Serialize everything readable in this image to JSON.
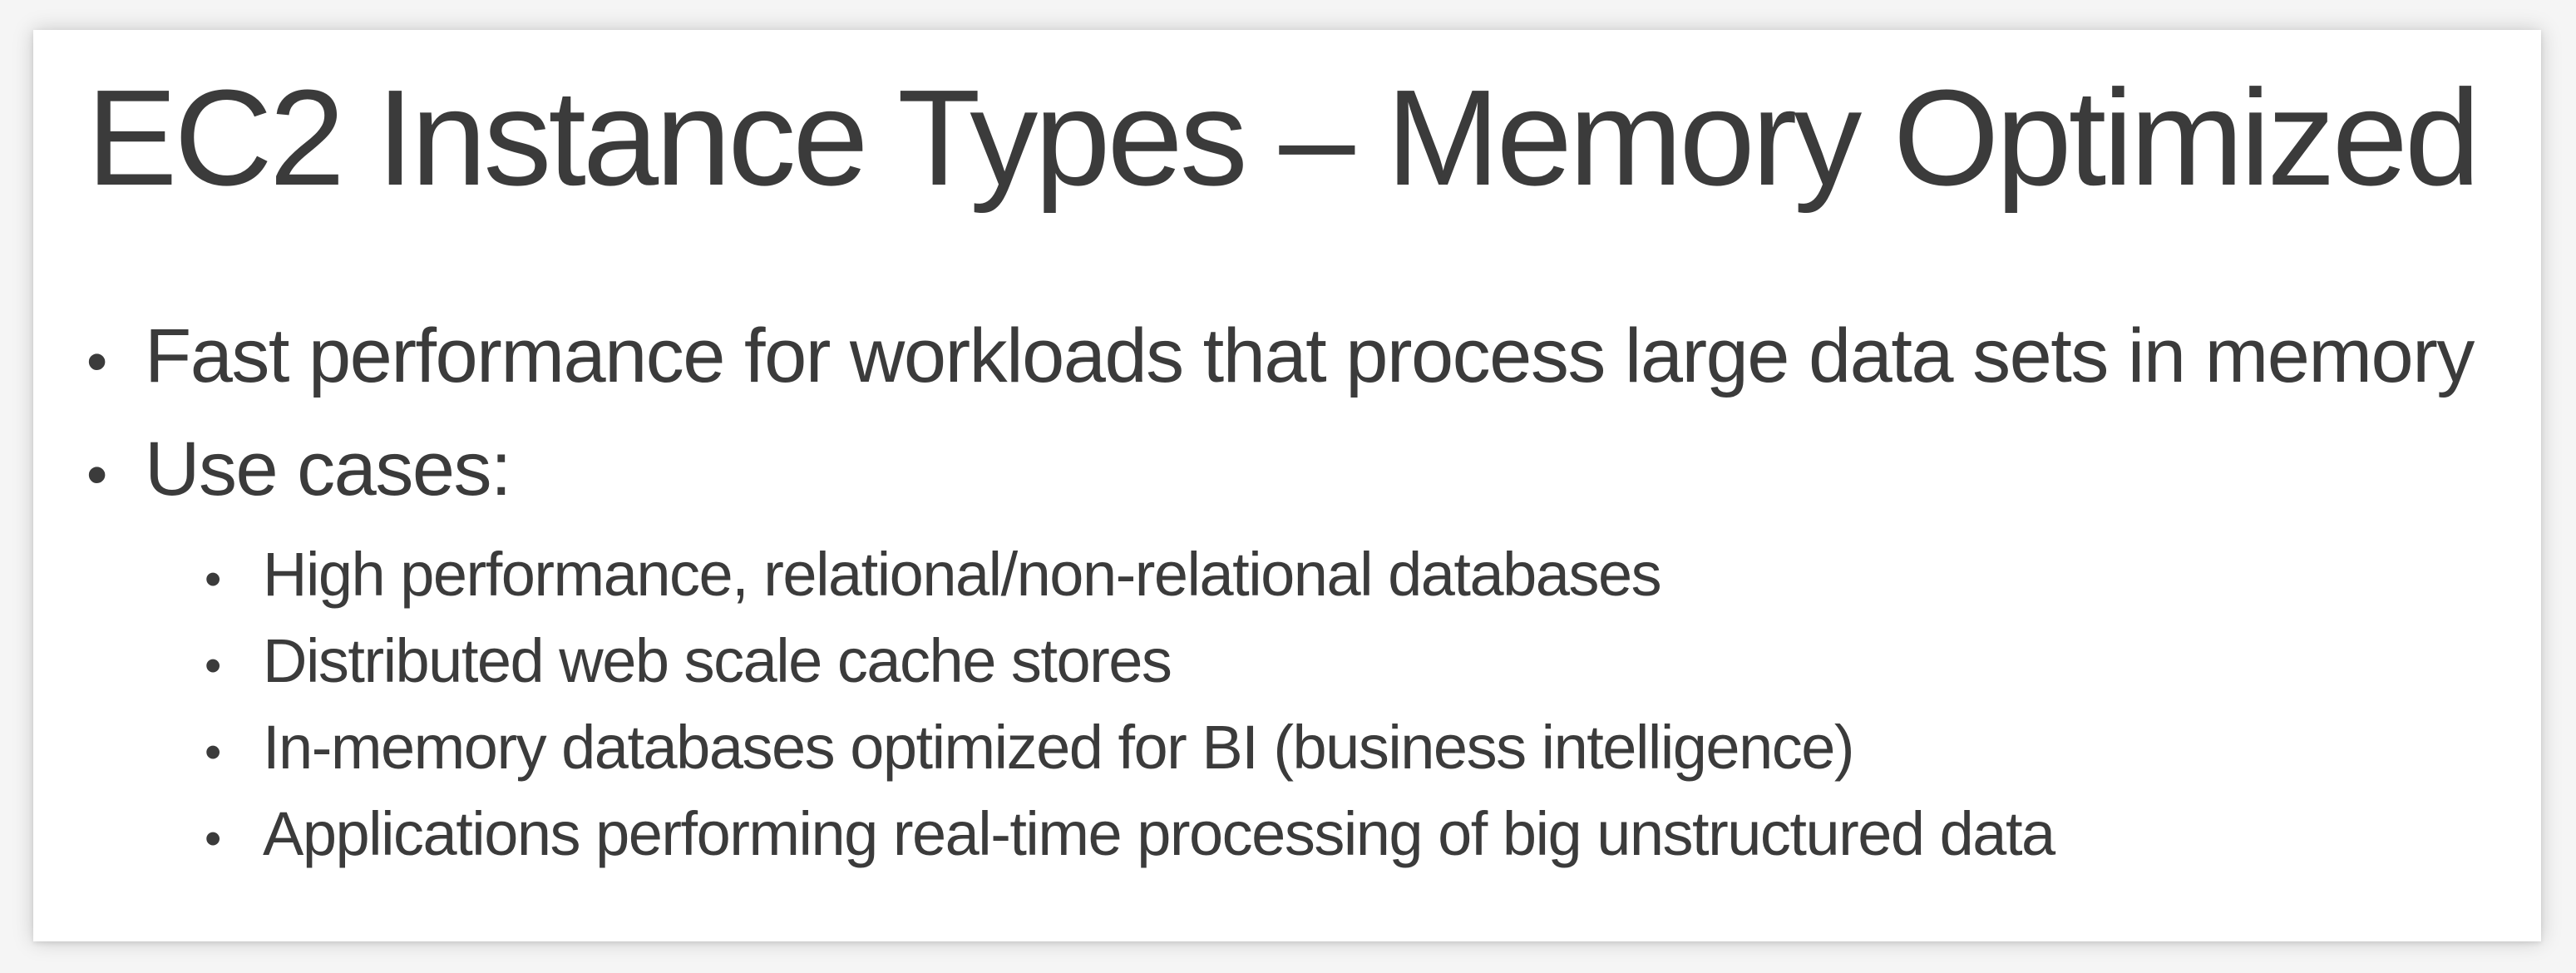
{
  "slide": {
    "title": "EC2 Instance Types – Memory Optimized",
    "bullets": [
      {
        "text": "Fast performance for workloads that process large data sets in memory"
      },
      {
        "text": "Use cases:"
      }
    ],
    "sub_bullets": [
      {
        "text": "High performance, relational/non-relational databases"
      },
      {
        "text": "Distributed web scale cache stores"
      },
      {
        "text": "In-memory databases optimized for BI (business intelligence)"
      },
      {
        "text": "Applications performing real-time processing of big unstructured data"
      }
    ],
    "bullet_glyph": "•"
  }
}
